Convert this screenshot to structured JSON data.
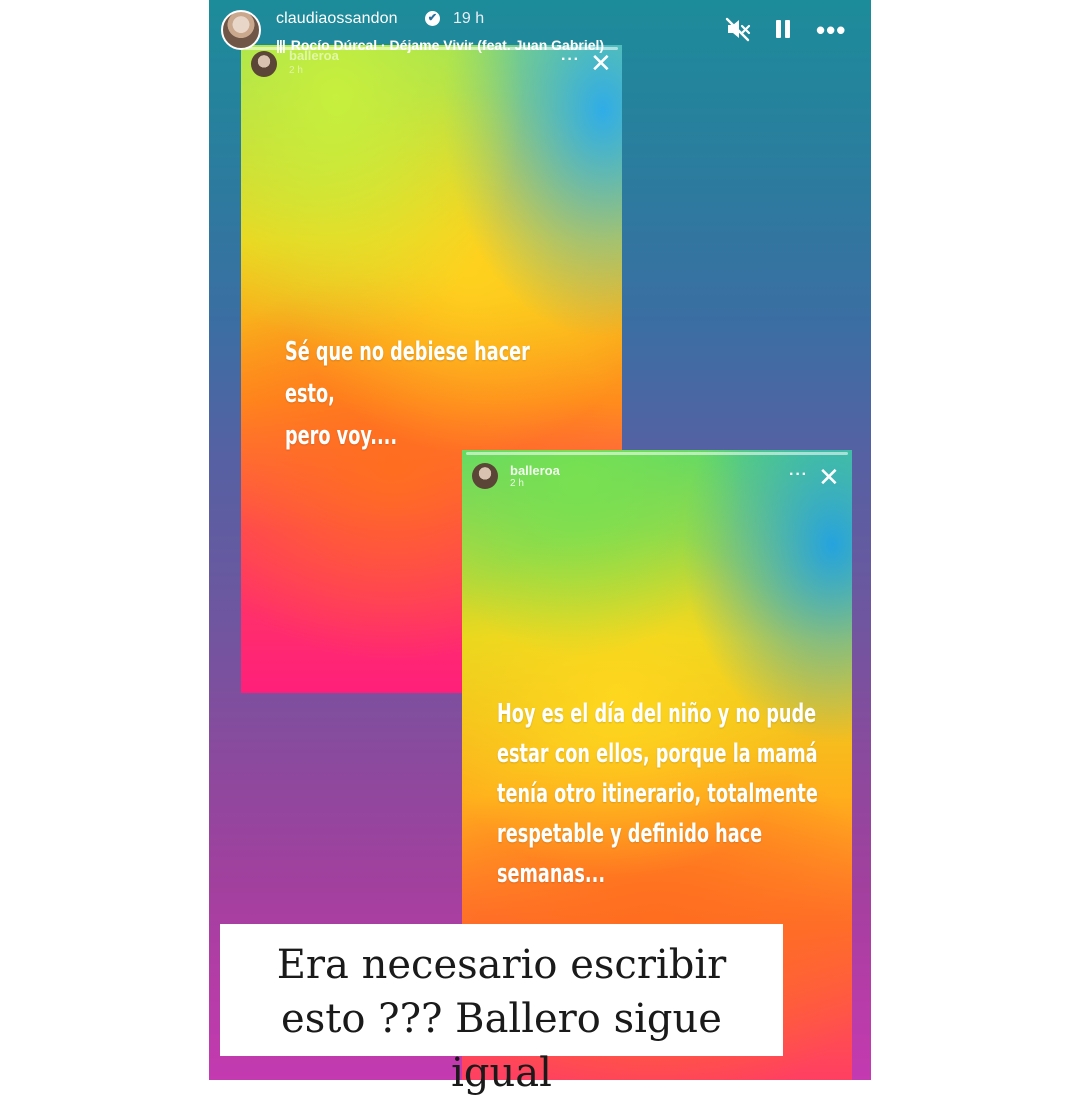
{
  "story": {
    "username": "claudiaossandon",
    "time": "19 h",
    "music": "Rocío Dúrcal · Déjame Vivir (feat. Juan Gabriel)",
    "music_icon": "|||",
    "verified_icon": "✔"
  },
  "card1": {
    "username": "balleroa",
    "time": "2 h",
    "text": "Sé que no debiese hacer esto,\npero voy...."
  },
  "card2": {
    "username": "balleroa",
    "time": "2 h",
    "text": "Hoy es el día del niño y no pude\nestar con ellos, porque la mamá\ntenía otro itinerario, totalmente\nrespetable y definido hace\nsemanas..."
  },
  "caption": {
    "text": "Era necesario escribir\nesto ??? Ballero sigue igual"
  },
  "icons": {
    "more": "•••",
    "close": "✕",
    "dots": "···"
  },
  "colors": {
    "caption_bg": "#ffffff",
    "caption_text": "#1a1a1a"
  }
}
